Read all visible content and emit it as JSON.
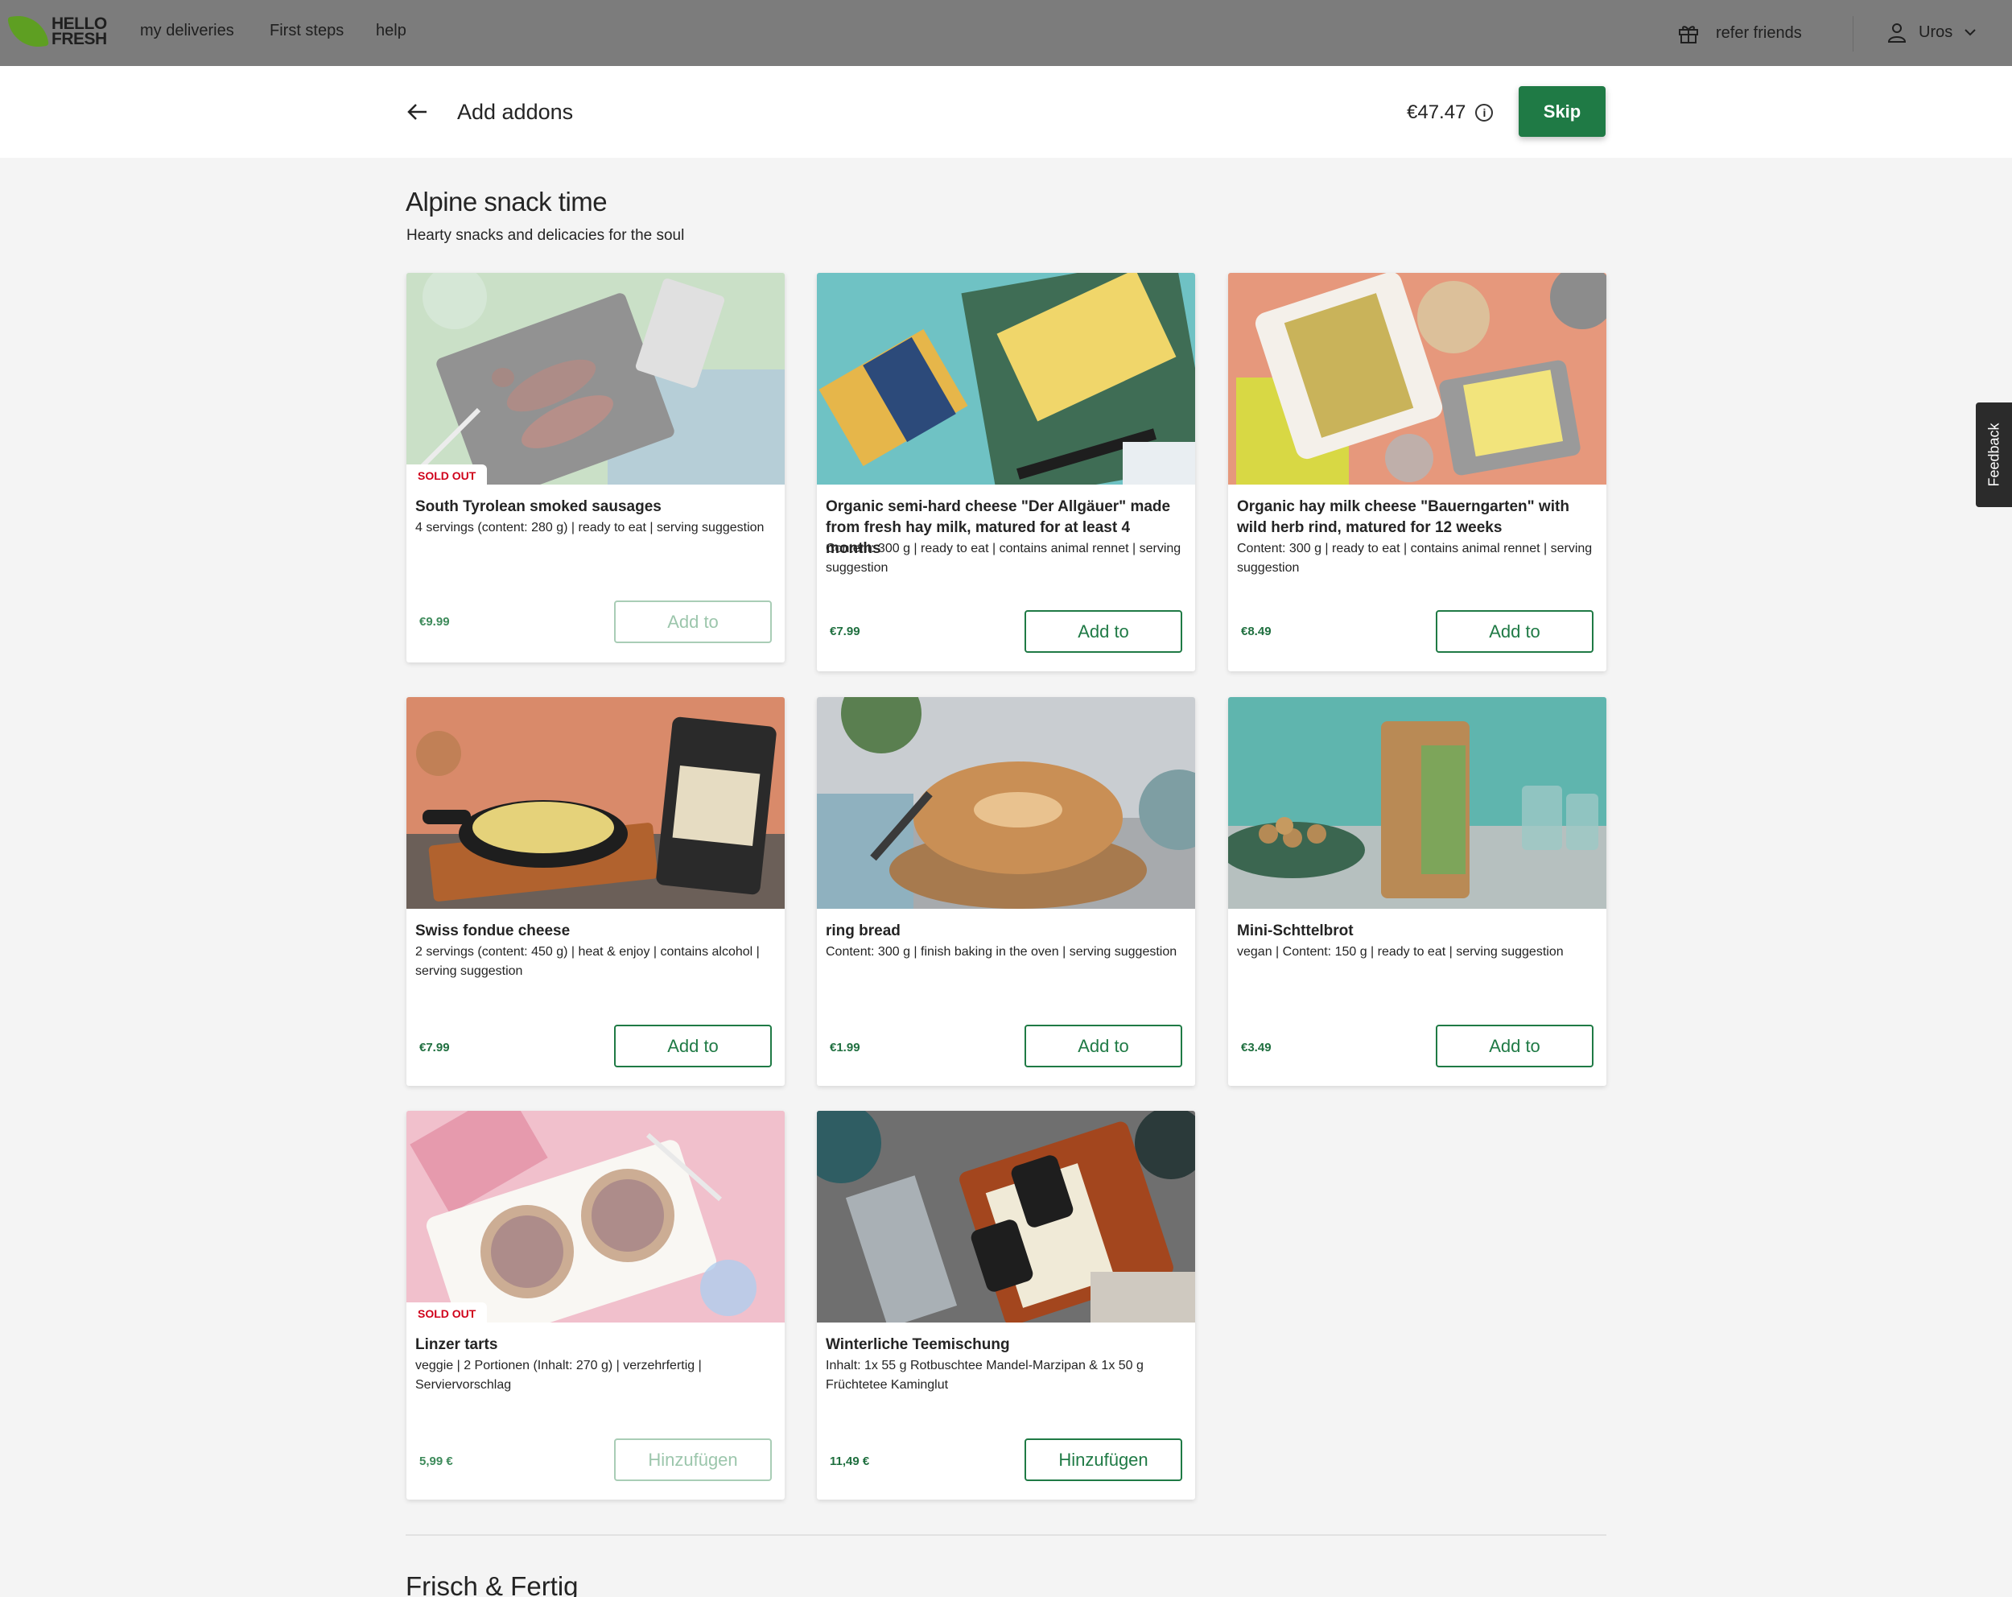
{
  "nav": {
    "brand_line1": "HELLO",
    "brand_line2": "FRESH",
    "links": [
      "my deliveries",
      "First steps",
      "help"
    ],
    "refer": "refer friends",
    "user": "Uros"
  },
  "header": {
    "title": "Add addons",
    "total": "€47.47",
    "info": "i",
    "skip": "Skip"
  },
  "section": {
    "title": "Alpine snack time",
    "subtitle": "Hearty snacks and delicacies for the soul"
  },
  "products": [
    {
      "name": "South Tyrolean smoked sausages",
      "desc": "4 servings (content: 280 g) | ready to eat | serving suggestion",
      "price": "€9.99",
      "button": "Add to",
      "badge": "SOLD OUT"
    },
    {
      "name": "Organic semi-hard cheese \"Der Allgäuer\" made from fresh hay milk, matured for at least 4 months",
      "desc": "Content: 300 g | ready to eat | contains animal rennet | serving suggestion",
      "price": "€7.99",
      "button": "Add to"
    },
    {
      "name": "Organic hay milk cheese \"Bauerngarten\" with wild herb rind, matured for 12 weeks",
      "desc": "Content: 300 g | ready to eat | contains animal rennet | serving suggestion",
      "price": "€8.49",
      "button": "Add to"
    },
    {
      "name": "Swiss fondue cheese",
      "desc": "2 servings (content: 450 g) | heat & enjoy | contains alcohol | serving suggestion",
      "price": "€7.99",
      "button": "Add to"
    },
    {
      "name": "ring bread",
      "desc": "Content: 300 g | finish baking in the oven | serving suggestion",
      "price": "€1.99",
      "button": "Add to"
    },
    {
      "name": "Mini-Schttelbrot",
      "desc": "vegan | Content: 150 g | ready to eat | serving suggestion",
      "price": "€3.49",
      "button": "Add to"
    },
    {
      "name": "Linzer tarts",
      "desc": "veggie | 2 Portionen (Inhalt: 270 g) | verzehrfertig | Serviervorschlag",
      "price": "5,99 €",
      "button": "Hinzufügen",
      "badge": "SOLD OUT"
    },
    {
      "name": "Winterliche Teemischung",
      "desc": "Inhalt: 1x 55 g Rotbuschtee Mandel-Marzipan & 1x 50 g Früchtetee Kaminglut",
      "price": "11,49 €",
      "button": "Hinzufügen"
    }
  ],
  "next_section": {
    "title": "Frisch & Fertig"
  },
  "feedback": "Feedback",
  "colors": {
    "accent": "#1f7a45",
    "sold_out": "#d0021b",
    "topbar": "#7c7c7c"
  }
}
